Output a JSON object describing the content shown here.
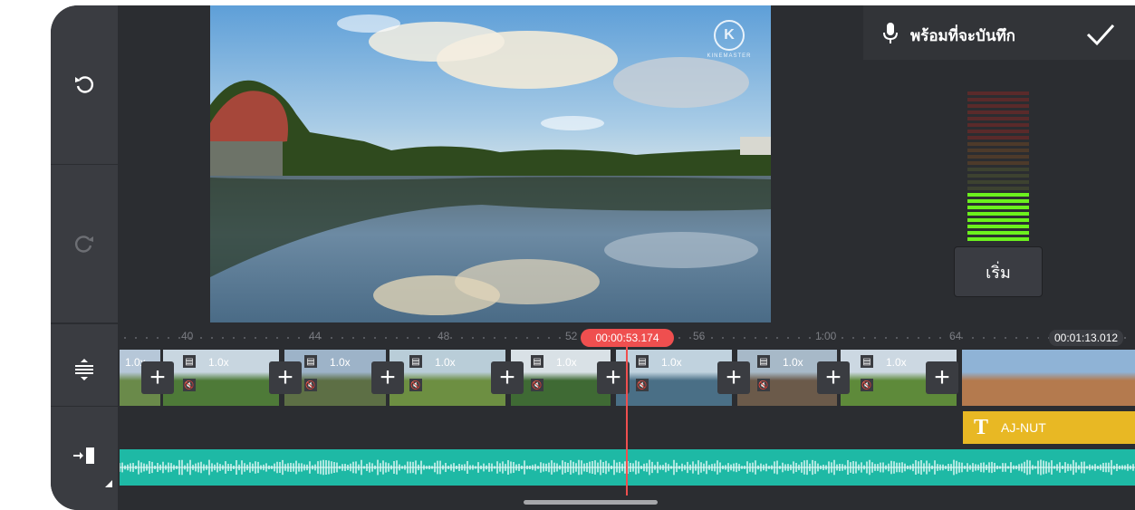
{
  "toolbar": {
    "undo_icon": "undo-icon",
    "redo_icon": "redo-icon"
  },
  "watermark": {
    "letter": "K",
    "text": "KINEMASTER"
  },
  "record": {
    "status_label": "พร้อมที่จะบันทึก",
    "mic_icon": "microphone-icon",
    "confirm_icon": "checkmark-icon",
    "start_label": "เริ่ม",
    "level_active_bars": 8,
    "level_total_bars": 24
  },
  "timeline": {
    "ruler_ticks": [
      "40",
      "44",
      "48",
      "52",
      "56",
      "1:00",
      "64"
    ],
    "playhead_time": "00:00:53.174",
    "total_time": "00:01:13.012",
    "clip_speed": "1.0x",
    "text_layer_label": "AJ-NUT",
    "text_layer_icon": "T"
  },
  "colors": {
    "accent_red": "#ef4f4f",
    "audio_teal": "#1eb9a5",
    "text_layer_yellow": "#e8b824",
    "level_green": "#6cf01e"
  }
}
